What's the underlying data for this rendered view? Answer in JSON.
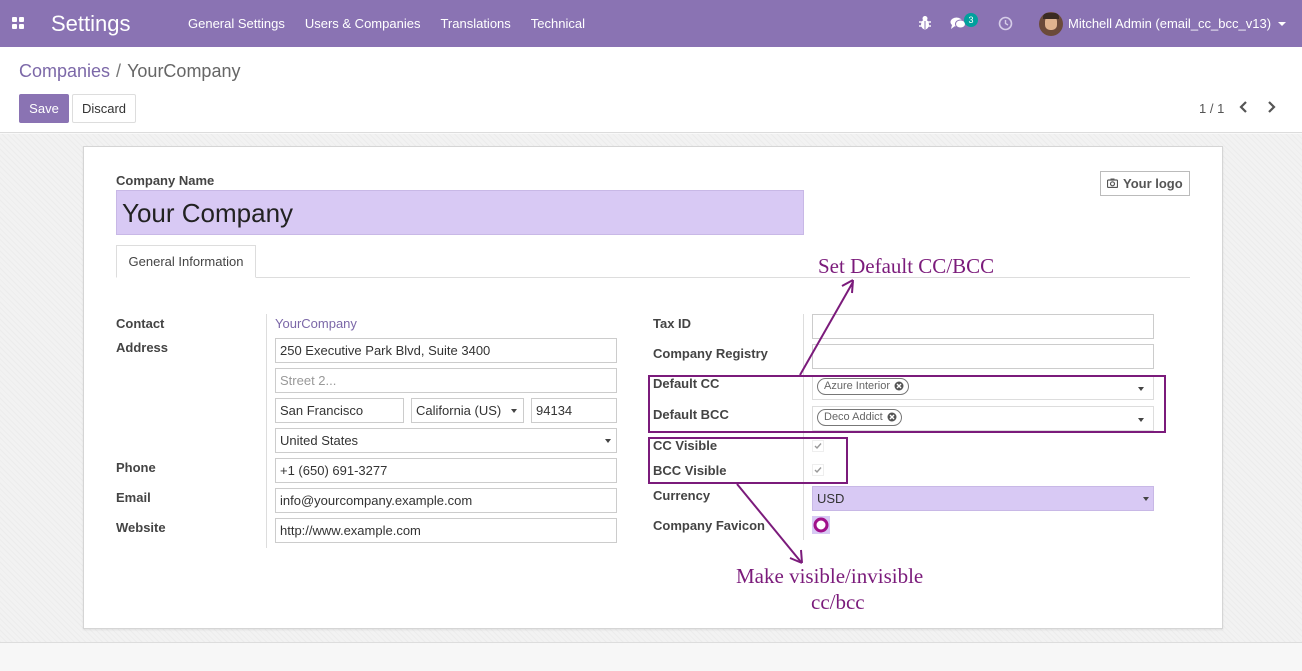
{
  "navbar": {
    "app_title": "Settings",
    "menu": [
      "General Settings",
      "Users & Companies",
      "Translations",
      "Technical"
    ],
    "chat_badge": "3",
    "user_name": "Mitchell Admin (email_cc_bcc_v13)",
    "color": "#8a73b3"
  },
  "control_panel": {
    "breadcrumb_parent": "Companies",
    "breadcrumb_separator": "/",
    "breadcrumb_current": "YourCompany",
    "save_label": "Save",
    "discard_label": "Discard",
    "pager": "1 / 1"
  },
  "form": {
    "company_name_label": "Company Name",
    "company_name": "Your Company",
    "logo_label": "Your logo",
    "tab_general": "General Information",
    "contact_label": "Contact",
    "contact_value": "YourCompany",
    "address_label": "Address",
    "street": "250 Executive Park Blvd, Suite 3400",
    "street2_placeholder": "Street 2...",
    "city": "San Francisco",
    "state": "California (US)",
    "zip": "94134",
    "country": "United States",
    "phone_label": "Phone",
    "phone": "+1 (650) 691-3277",
    "email_label": "Email",
    "email": "info@yourcompany.example.com",
    "website_label": "Website",
    "website": "http://www.example.com",
    "tax_id_label": "Tax ID",
    "tax_id": "",
    "registry_label": "Company Registry",
    "registry": "",
    "default_cc_label": "Default CC",
    "default_cc_tag": "Azure Interior",
    "default_bcc_label": "Default BCC",
    "default_bcc_tag": "Deco Addict",
    "cc_visible_label": "CC Visible",
    "cc_visible": true,
    "bcc_visible_label": "BCC Visible",
    "bcc_visible": true,
    "currency_label": "Currency",
    "currency": "USD",
    "favicon_label": "Company Favicon"
  },
  "annotations": {
    "set_default": "Set  Default  CC/BCC",
    "make_visible_line1": "Make  visible/invisible",
    "make_visible_line2": "cc/bcc",
    "color": "#7b1b7b"
  }
}
